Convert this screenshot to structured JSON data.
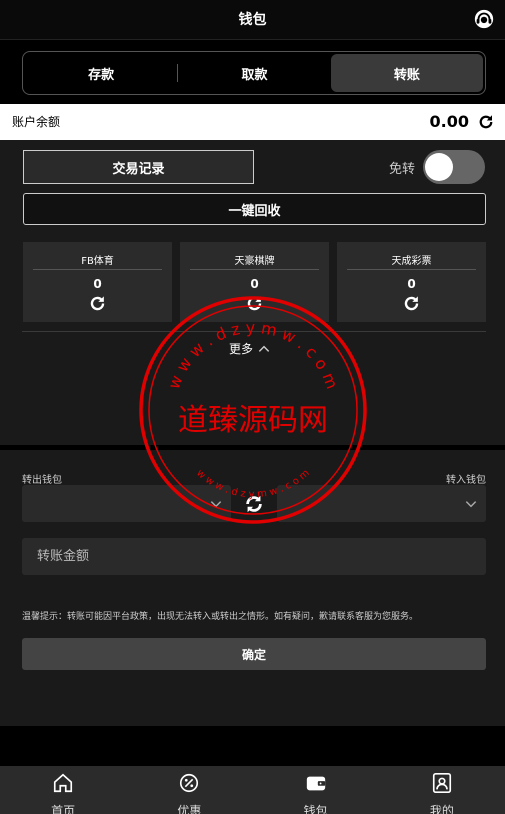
{
  "header": {
    "title": "钱包",
    "support_icon": "customer-service-icon"
  },
  "tabs": [
    {
      "label": "存款",
      "active": false
    },
    {
      "label": "取款",
      "active": false
    },
    {
      "label": "转账",
      "active": true
    }
  ],
  "balance": {
    "label": "账户余额",
    "value": "0.00",
    "refresh_icon": "refresh-icon"
  },
  "actions": {
    "history_label": "交易记录",
    "free_transfer_label": "免转",
    "recycle_label": "一键回收"
  },
  "games": [
    {
      "name": "FB体育",
      "value": "0"
    },
    {
      "name": "天豪棋牌",
      "value": "0"
    },
    {
      "name": "天成彩票",
      "value": "0"
    }
  ],
  "more_label": "更多",
  "transfer": {
    "from_label": "转出钱包",
    "to_label": "转入钱包",
    "amount_placeholder": "转账金额",
    "notice": "温馨提示：转账可能因平台政策，出现无法转入或转出之情形。如有疑问，歉请联系客服为您服务。",
    "confirm_label": "确定"
  },
  "nav": [
    {
      "label": "首页",
      "icon": "home-icon"
    },
    {
      "label": "优惠",
      "icon": "discount-icon"
    },
    {
      "label": "钱包",
      "icon": "wallet-icon"
    },
    {
      "label": "我的",
      "icon": "profile-icon"
    }
  ],
  "watermark": {
    "text": "道臻源码网",
    "outer_top": "w w w . d z y m w . c o m",
    "inner_bottom": "w w w . d z y m w . c o m",
    "color": "#e00000"
  },
  "colors": {
    "background": "#000000",
    "panel": "#1a1a1a",
    "card": "#2b2b2b",
    "active_tab": "#3a3a3a"
  }
}
